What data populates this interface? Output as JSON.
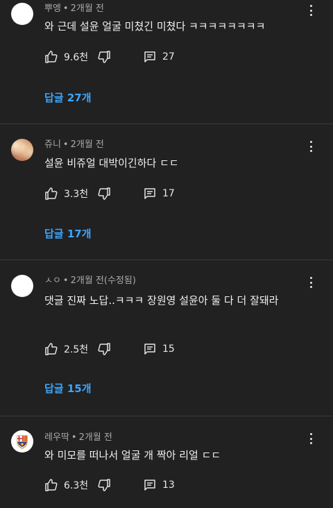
{
  "comments": [
    {
      "author": "뿌엥",
      "time": "2개월 전",
      "text": "와 근데 설윤 얼굴 미쳤긴 미쳤다 ㅋㅋㅋㅋㅋㅋㅋㅋ",
      "likes": "9.6천",
      "reply_count": "27",
      "replies_label": "답글 27개",
      "avatar": "white"
    },
    {
      "author": "쥬니",
      "time": "2개월 전",
      "text": "설윤 비쥬얼 대박이긴하다 ㄷㄷ",
      "likes": "3.3천",
      "reply_count": "17",
      "replies_label": "답글 17개",
      "avatar": "photo"
    },
    {
      "author": "ㅅㅇ",
      "time": "2개월 전(수정됨)",
      "text": "댓글 진짜 노답..ㅋㅋㅋ 장원영 설윤아 둘 다 더 잘돼라",
      "likes": "2.5천",
      "reply_count": "15",
      "replies_label": "답글 15개",
      "avatar": "white"
    },
    {
      "author": "레우딱",
      "time": "2개월 전",
      "text": "와 미모를 떠나서 얼굴 개 짝아 리얼 ㄷㄷ",
      "likes": "6.3천",
      "reply_count": "13",
      "avatar": "club-crest"
    }
  ],
  "icons": {
    "like": "thumbs-up-icon",
    "dislike": "thumbs-down-icon",
    "reply": "comment-icon",
    "more": "more-vertical-icon"
  },
  "colors": {
    "background": "#212121",
    "link": "#3ea6ff",
    "meta": "#aaaaaa",
    "text": "#f1f1f1"
  }
}
